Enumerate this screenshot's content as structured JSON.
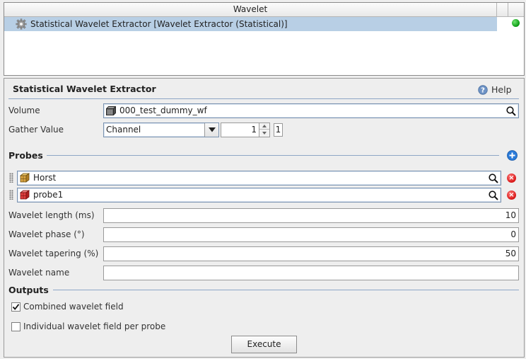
{
  "table": {
    "header_title": "Wavelet",
    "row_label": "Statistical Wavelet Extractor [Wavelet Extractor (Statistical)]",
    "row_status_color": "#0a9a12"
  },
  "panel": {
    "title": "Statistical Wavelet Extractor",
    "help_label": "Help"
  },
  "volume": {
    "label": "Volume",
    "value": "000_test_dummy_wf"
  },
  "gather": {
    "label": "Gather Value",
    "selected_option": "Channel",
    "spinner_value": "1",
    "max_value": "1"
  },
  "probes": {
    "section_title": "Probes",
    "items": [
      {
        "name": "Horst",
        "icon": "cube-yellow-icon"
      },
      {
        "name": "probe1",
        "icon": "cube-red-icon"
      }
    ]
  },
  "params": {
    "length_label": "Wavelet length (ms)",
    "length_value": "10",
    "phase_label": "Wavelet phase (°)",
    "phase_value": "0",
    "tapering_label": "Wavelet tapering (%)",
    "tapering_value": "50",
    "name_label": "Wavelet name",
    "name_value": ""
  },
  "outputs": {
    "section_title": "Outputs",
    "combined_label": "Combined wavelet field",
    "combined_checked": true,
    "individual_label": "Individual wavelet field per probe",
    "individual_checked": false
  },
  "execute_label": "Execute",
  "colors": {
    "selection": "#b8cfe5",
    "accent_blue": "#2a7ad8",
    "remove_red": "#d81515"
  }
}
